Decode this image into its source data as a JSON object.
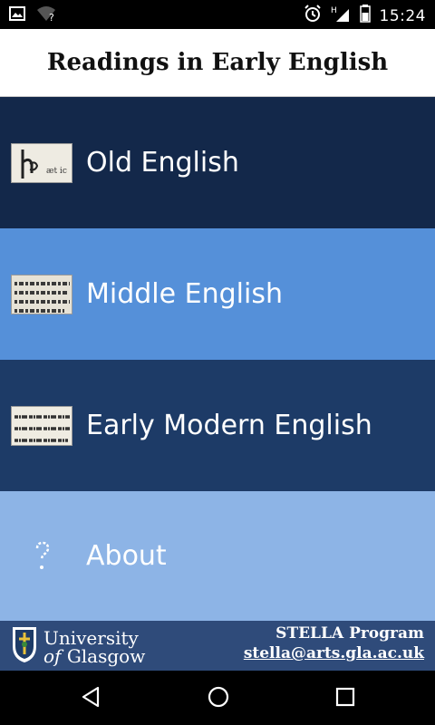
{
  "status": {
    "time": "15:24",
    "icons": [
      "image-icon",
      "wifi-unknown-icon",
      "alarm-icon",
      "signal-icon",
      "battery-icon"
    ]
  },
  "title": "Readings in Early English",
  "menu": [
    {
      "label": "Old English",
      "bg": "#13284a",
      "thumb": "old-english-manuscript"
    },
    {
      "label": "Middle English",
      "bg": "#5590d9",
      "thumb": "middle-english-manuscript"
    },
    {
      "label": "Early Modern English",
      "bg": "#1d3b67",
      "thumb": "early-modern-english-print"
    },
    {
      "label": "About",
      "bg": "#8db4e6",
      "thumb": "question-icon"
    }
  ],
  "footer": {
    "university_line1": "University",
    "university_of": "of",
    "university_line2": "Glasgow",
    "program": "STELLA Program",
    "email": "stella@arts.gla.ac.uk"
  },
  "colors": {
    "footer_bg": "#2f4b7a",
    "title_bg": "#ffffff"
  }
}
